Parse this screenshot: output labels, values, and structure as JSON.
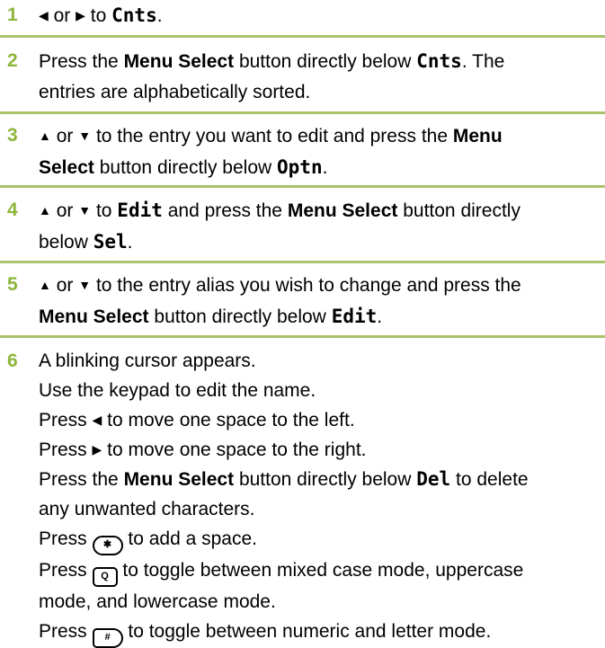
{
  "steps": [
    {
      "number": "1",
      "text": {
        "a": "or",
        "b": "to",
        "c": "Cnts",
        "d": "."
      }
    },
    {
      "number": "2",
      "text": {
        "a": "Press the",
        "b": "Menu Select",
        "c": "button directly below",
        "d": "Cnts",
        "e": ". The",
        "f": "entries are alphabetically sorted."
      }
    },
    {
      "number": "3",
      "text": {
        "a": "or",
        "b": "to the entry you want to edit and press the",
        "c": "Menu",
        "d": "Select",
        "e": "button directly below",
        "f": "Optn",
        "g": "."
      }
    },
    {
      "number": "4",
      "text": {
        "a": "or",
        "b": "to",
        "c": "Edit",
        "d": "and press the",
        "e": "Menu Select",
        "f": "button directly",
        "g": "below",
        "h": "Sel",
        "i": "."
      }
    },
    {
      "number": "5",
      "text": {
        "a": "or",
        "b": "to the entry alias you wish to change and press the",
        "c": "Menu Select",
        "d": "button directly below",
        "e": "Edit",
        "f": "."
      }
    },
    {
      "number": "6",
      "lines": {
        "l1": "A blinking cursor appears.",
        "l2": "Use the keypad to edit the name.",
        "l3a": "Press",
        "l3b": "to move one space to the left.",
        "l4a": "Press",
        "l4b": "to move one space to the right.",
        "l5a": "Press the",
        "l5b": "Menu Select",
        "l5c": "button directly below",
        "l5d": "Del",
        "l5e": "to delete",
        "l5f": "any unwanted characters.",
        "l6a": "Press",
        "l6b": "to add a space.",
        "l7a": "Press",
        "l7b": "to toggle between mixed case mode, uppercase",
        "l7c": "mode, and lowercase mode.",
        "l8a": "Press",
        "l8b": "to toggle between numeric and letter mode."
      }
    }
  ],
  "icons": {
    "left": "left-arrow-icon",
    "right": "right-arrow-icon",
    "up": "up-arrow-icon",
    "down": "down-arrow-icon",
    "star_key": "star-key-icon",
    "q_key": "q-key-icon",
    "hash_key": "hash-del-key-icon"
  },
  "colors": {
    "step_number": "#8cb53a",
    "rule": "#a8c36a"
  }
}
